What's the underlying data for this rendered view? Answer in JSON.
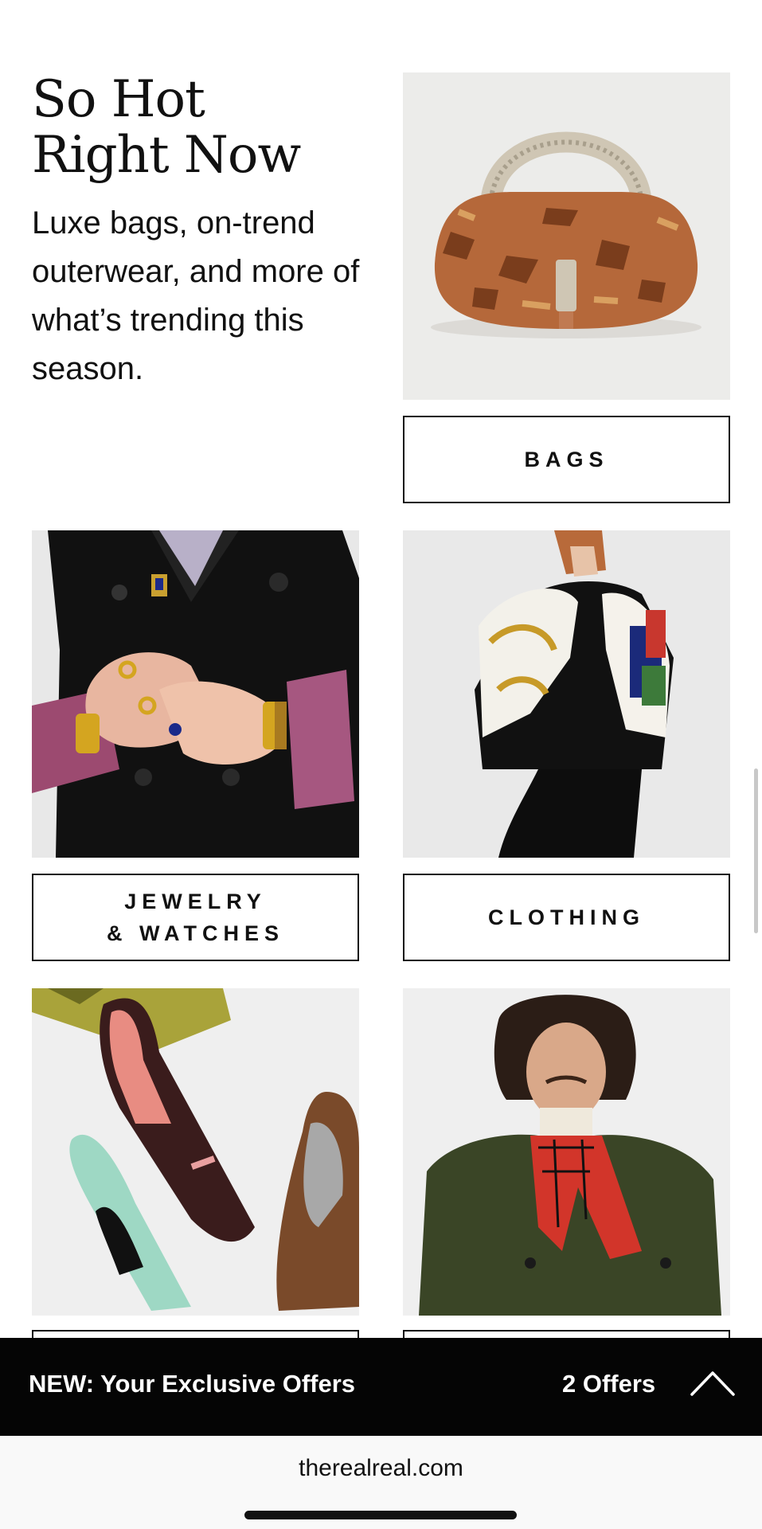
{
  "hero": {
    "title_line1": "So Hot",
    "title_line2": "Right Now",
    "description": "Luxe bags, on-trend outerwear, and more of what’s trending this season."
  },
  "categories": [
    {
      "label": "BAGS",
      "image": "snakeskin-handbag"
    },
    {
      "label_line1": "JEWELRY",
      "label_line2": "& WATCHES",
      "image": "hands-with-rings"
    },
    {
      "label": "CLOTHING",
      "image": "model-in-silk-scarf-cape"
    },
    {
      "image": "pointed-shoes-flatlay"
    },
    {
      "image": "man-in-green-jacket-plaid-scarf"
    }
  ],
  "offers_bar": {
    "title": "NEW: Your Exclusive Offers",
    "count": "2 Offers",
    "icon": "chevron-up-icon"
  },
  "browser": {
    "url": "therealreal.com"
  }
}
